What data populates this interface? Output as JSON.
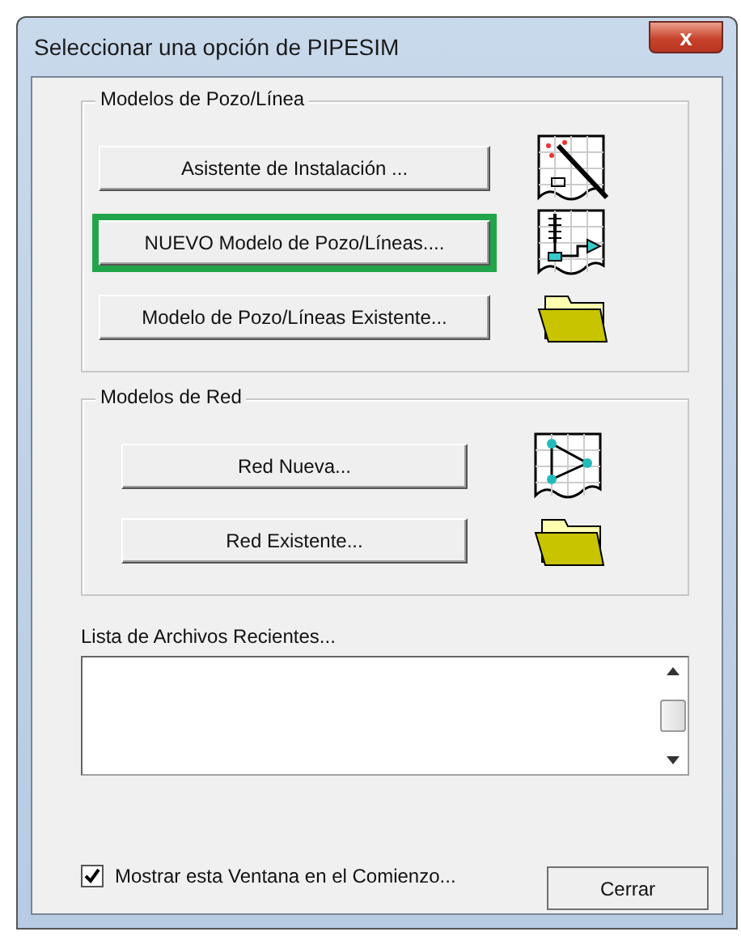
{
  "window": {
    "title": "Seleccionar una opción de PIPESIM",
    "close_label": "x"
  },
  "groups": [
    {
      "title": "Modelos de Pozo/Línea",
      "buttons": [
        {
          "label": "Asistente de Instalación ...",
          "highlighted": false,
          "kind": "wizard"
        },
        {
          "label": "NUEVO Modelo de Pozo/Líneas....",
          "highlighted": true,
          "kind": "well"
        },
        {
          "label": "Modelo de Pozo/Líneas Existente...",
          "highlighted": false,
          "kind": "folder"
        }
      ]
    },
    {
      "title": "Modelos de Red",
      "buttons": [
        {
          "label": "Red Nueva...",
          "highlighted": false,
          "kind": "network"
        },
        {
          "label": "Red Existente...",
          "highlighted": false,
          "kind": "folder"
        }
      ]
    }
  ],
  "recent": {
    "label": "Lista de Archivos Recientes..."
  },
  "show_at_start": {
    "label": "Mostrar esta Ventana en el Comienzo...",
    "checked": true
  },
  "close_button": "Cerrar"
}
